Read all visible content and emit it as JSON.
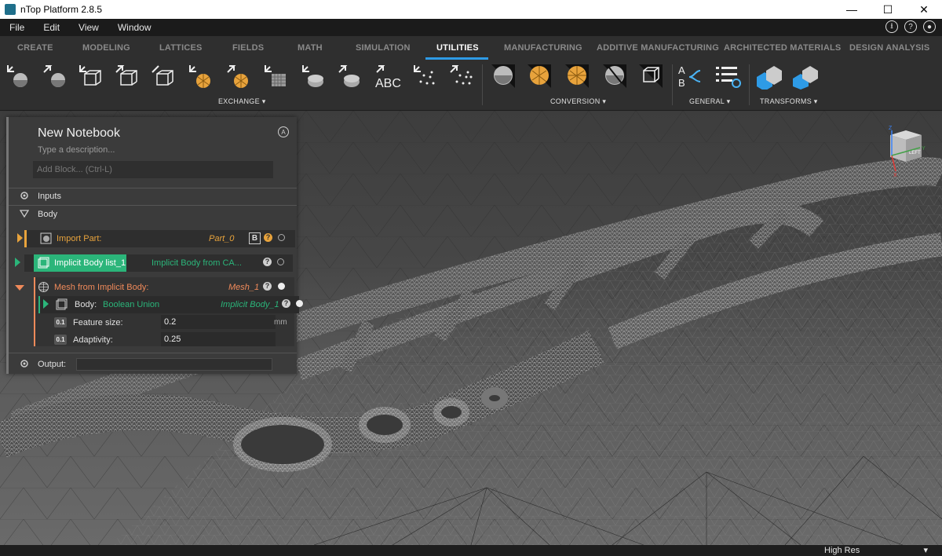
{
  "window": {
    "title": "nTop Platform 2.8.5",
    "minimize": "—",
    "maximize": "☐",
    "close": "✕"
  },
  "menu": {
    "items": [
      "File",
      "Edit",
      "View",
      "Window"
    ]
  },
  "tabs": [
    {
      "label": "CREATE"
    },
    {
      "label": "MODELING"
    },
    {
      "label": "LATTICES"
    },
    {
      "label": "FIELDS"
    },
    {
      "label": "MATH"
    },
    {
      "label": "SIMULATION"
    },
    {
      "label": "UTILITIES",
      "active": true
    },
    {
      "label": "MANUFACTURING"
    },
    {
      "label": "ADDITIVE MANUFACTURING"
    },
    {
      "label": "ARCHITECTED MATERIALS"
    },
    {
      "label": "DESIGN ANALYSIS"
    }
  ],
  "ribbon": {
    "groups": {
      "exchange": "EXCHANGE",
      "conversion": "CONVERSION",
      "general": "GENERAL",
      "transforms": "TRANSFORMS"
    },
    "abc_text": "ABC",
    "general_text_a": "A",
    "general_text_b": "B"
  },
  "notebook": {
    "title": "New Notebook",
    "description_placeholder": "Type a description...",
    "add_block_placeholder": "Add Block... (Ctrl-L)",
    "inputs_label": "Inputs",
    "body_label": "Body",
    "output_label": "Output:",
    "blocks": {
      "import_part": {
        "name": "Import Part:",
        "value": "Part_0",
        "badge": "B",
        "help": "?"
      },
      "implicit_body_list": {
        "name": "Implicit Body list_1",
        "value": "Implicit Body from CA...",
        "help": "?"
      },
      "mesh_from_implicit": {
        "name": "Mesh from Implicit Body:",
        "value": "Mesh_1",
        "help": "?"
      },
      "body_input": {
        "label": "Body:",
        "type": "Boolean Union",
        "value": "Implicit Body_1",
        "help": "?"
      },
      "feature_size": {
        "icon": "0.1",
        "label": "Feature size:",
        "value": "0.2",
        "unit": "mm"
      },
      "adaptivity": {
        "icon": "0.1",
        "label": "Adaptivity:",
        "value": "0.25"
      }
    }
  },
  "viewcube": {
    "face": "LEFT",
    "axis_z": "Z",
    "axis_y": "Y",
    "axis_x": "X"
  },
  "status": {
    "resolution": "High Res"
  },
  "colors": {
    "accent": "#2e9be6",
    "import": "#e8a33c",
    "implicit": "#2bb57a",
    "mesh": "#f08a5a",
    "green": "#2bb57a"
  }
}
